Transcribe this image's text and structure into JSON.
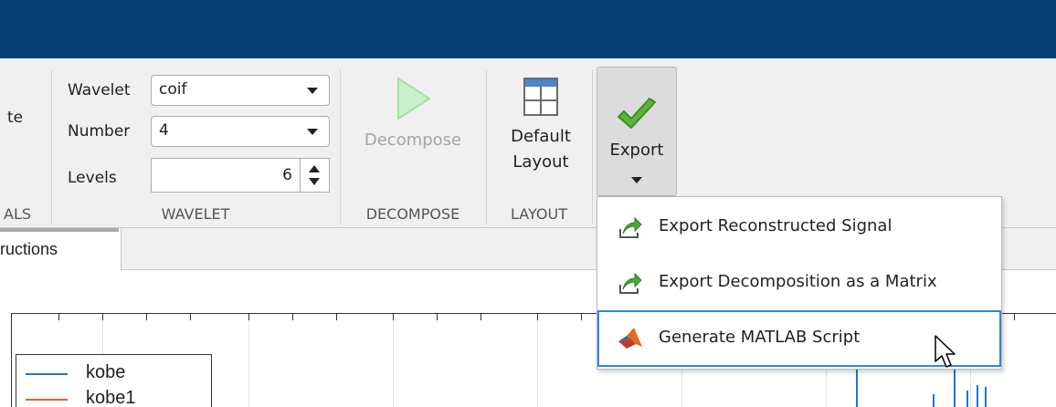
{
  "toolstrip": {
    "partial_left_text": "te",
    "wavelet": {
      "wavelet_label": "Wavelet",
      "wavelet_value": "coif",
      "number_label": "Number",
      "number_value": "4",
      "levels_label": "Levels",
      "levels_value": "6",
      "section_label": "WAVELET"
    },
    "signals_section_label": "ALS",
    "decompose": {
      "button_label": "Decompose",
      "section_label": "DECOMPOSE"
    },
    "layout": {
      "button_label_line1": "Default",
      "button_label_line2": "Layout",
      "section_label": "LAYOUT"
    },
    "export": {
      "button_label": "Export"
    }
  },
  "export_menu": {
    "items": [
      {
        "label": "Export Reconstructed Signal",
        "icon": "export-arrow-icon"
      },
      {
        "label": "Export Decomposition as a Matrix",
        "icon": "export-arrow-icon"
      },
      {
        "label": "Generate MATLAB Script",
        "icon": "matlab-logo-icon"
      }
    ]
  },
  "tabs": {
    "active_tab_label": "ructions"
  },
  "plot": {
    "legend": [
      {
        "name": "kobe",
        "color": "#1f77d0"
      },
      {
        "name": "kobe1",
        "color": "#e0622b"
      }
    ]
  },
  "colors": {
    "title_bar": "#033f73",
    "menu_highlight": "#2f89d8",
    "check_green": "#5cb33a"
  }
}
